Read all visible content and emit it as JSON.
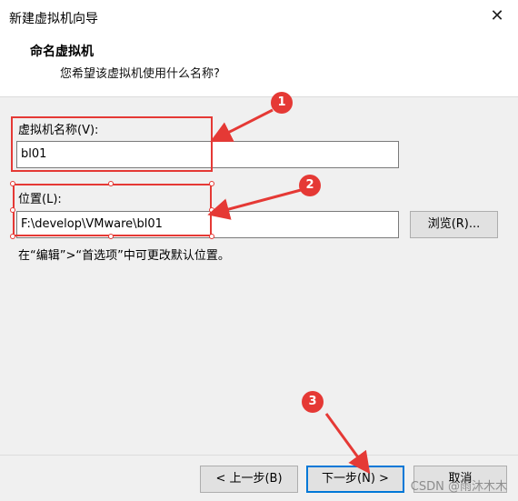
{
  "window": {
    "title": "新建虚拟机向导",
    "close_glyph": "✕"
  },
  "header": {
    "title": "命名虚拟机",
    "subtitle": "您希望该虚拟机使用什么名称?"
  },
  "form": {
    "name_label": "虚拟机名称(V):",
    "name_value": "bl01",
    "location_label": "位置(L):",
    "location_value": "F:\\develop\\VMware\\bl01",
    "browse_label": "浏览(R)...",
    "hint": "在“编辑”>“首选项”中可更改默认位置。"
  },
  "footer": {
    "back_label": "< 上一步(B)",
    "next_label": "下一步(N) >",
    "cancel_label": "取消"
  },
  "annotations": {
    "badge_1": "1",
    "badge_2": "2",
    "badge_3": "3",
    "color": "#e53935"
  },
  "watermark": "CSDN @雨沐木木"
}
